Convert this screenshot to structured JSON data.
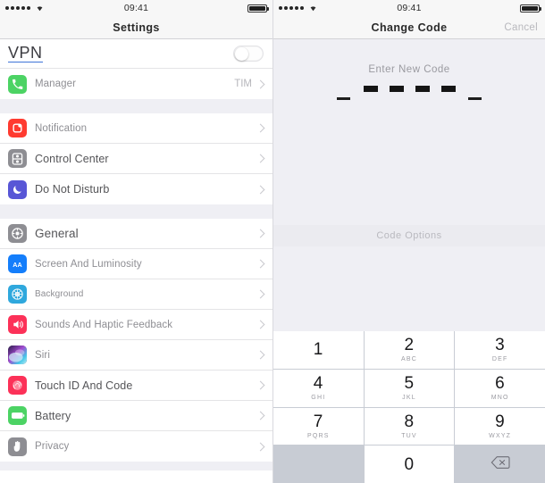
{
  "status_bar": {
    "signal_dots": 5,
    "wifi_icon": "wifi-icon",
    "time": "09:41",
    "battery_icon": "battery-full-icon"
  },
  "left_panel": {
    "nav": {
      "title": "Settings"
    },
    "vpn_row": {
      "label": "VPN",
      "toggle_state": "off",
      "toggle_name": "vpn-toggle"
    },
    "manager_row": {
      "icon": "phone-icon",
      "icon_color": "#4cd364",
      "label": "Manager",
      "value": "TIM"
    },
    "group_notifications": [
      {
        "icon": "notification-icon",
        "icon_color": "#ff3b30",
        "label": "Notification"
      },
      {
        "icon": "control-center-icon",
        "icon_color": "#8e8e93",
        "label": "Control Center"
      },
      {
        "icon": "moon-icon",
        "icon_color": "#5856d6",
        "label": "Do Not Disturb"
      }
    ],
    "group_general": [
      {
        "icon": "gear-icon",
        "icon_color": "#8e8e93",
        "label": "General",
        "emphasis": true
      },
      {
        "icon": "display-text-icon",
        "icon_color": "#147efb",
        "label": "Screen And Luminosity"
      },
      {
        "icon": "wallpaper-icon",
        "icon_color": "#2fa8dd",
        "label": "Background"
      },
      {
        "icon": "speaker-icon",
        "icon_color": "#fc3158",
        "label": "Sounds And Haptic Feedback"
      },
      {
        "icon": "siri-icon",
        "icon_color": "#2b2b4a",
        "label": "Siri"
      },
      {
        "icon": "fingerprint-icon",
        "icon_color": "#fc3158",
        "label": "Touch ID And Code"
      },
      {
        "icon": "battery-icon",
        "icon_color": "#4cd364",
        "label": "Battery"
      },
      {
        "icon": "hand-icon",
        "icon_color": "#8e8e93",
        "label": "Privacy"
      }
    ]
  },
  "right_panel": {
    "nav": {
      "title": "Change Code",
      "cancel_label": "Cancel"
    },
    "code_entry": {
      "prompt": "Enter New Code",
      "filled_count": 4,
      "edge_marks": 2
    },
    "code_options_label": "Code Options",
    "keypad": [
      {
        "num": "1",
        "sub": ""
      },
      {
        "num": "2",
        "sub": "ABC"
      },
      {
        "num": "3",
        "sub": "DEF"
      },
      {
        "num": "4",
        "sub": "GHI"
      },
      {
        "num": "5",
        "sub": "JKL"
      },
      {
        "num": "6",
        "sub": "MNO"
      },
      {
        "num": "7",
        "sub": "PQRS"
      },
      {
        "num": "8",
        "sub": "TUV"
      },
      {
        "num": "9",
        "sub": "WXYZ"
      },
      {
        "num": "",
        "sub": ""
      },
      {
        "num": "0",
        "sub": ""
      },
      {
        "num": "",
        "sub": "",
        "icon": "delete-backspace-icon"
      }
    ]
  }
}
